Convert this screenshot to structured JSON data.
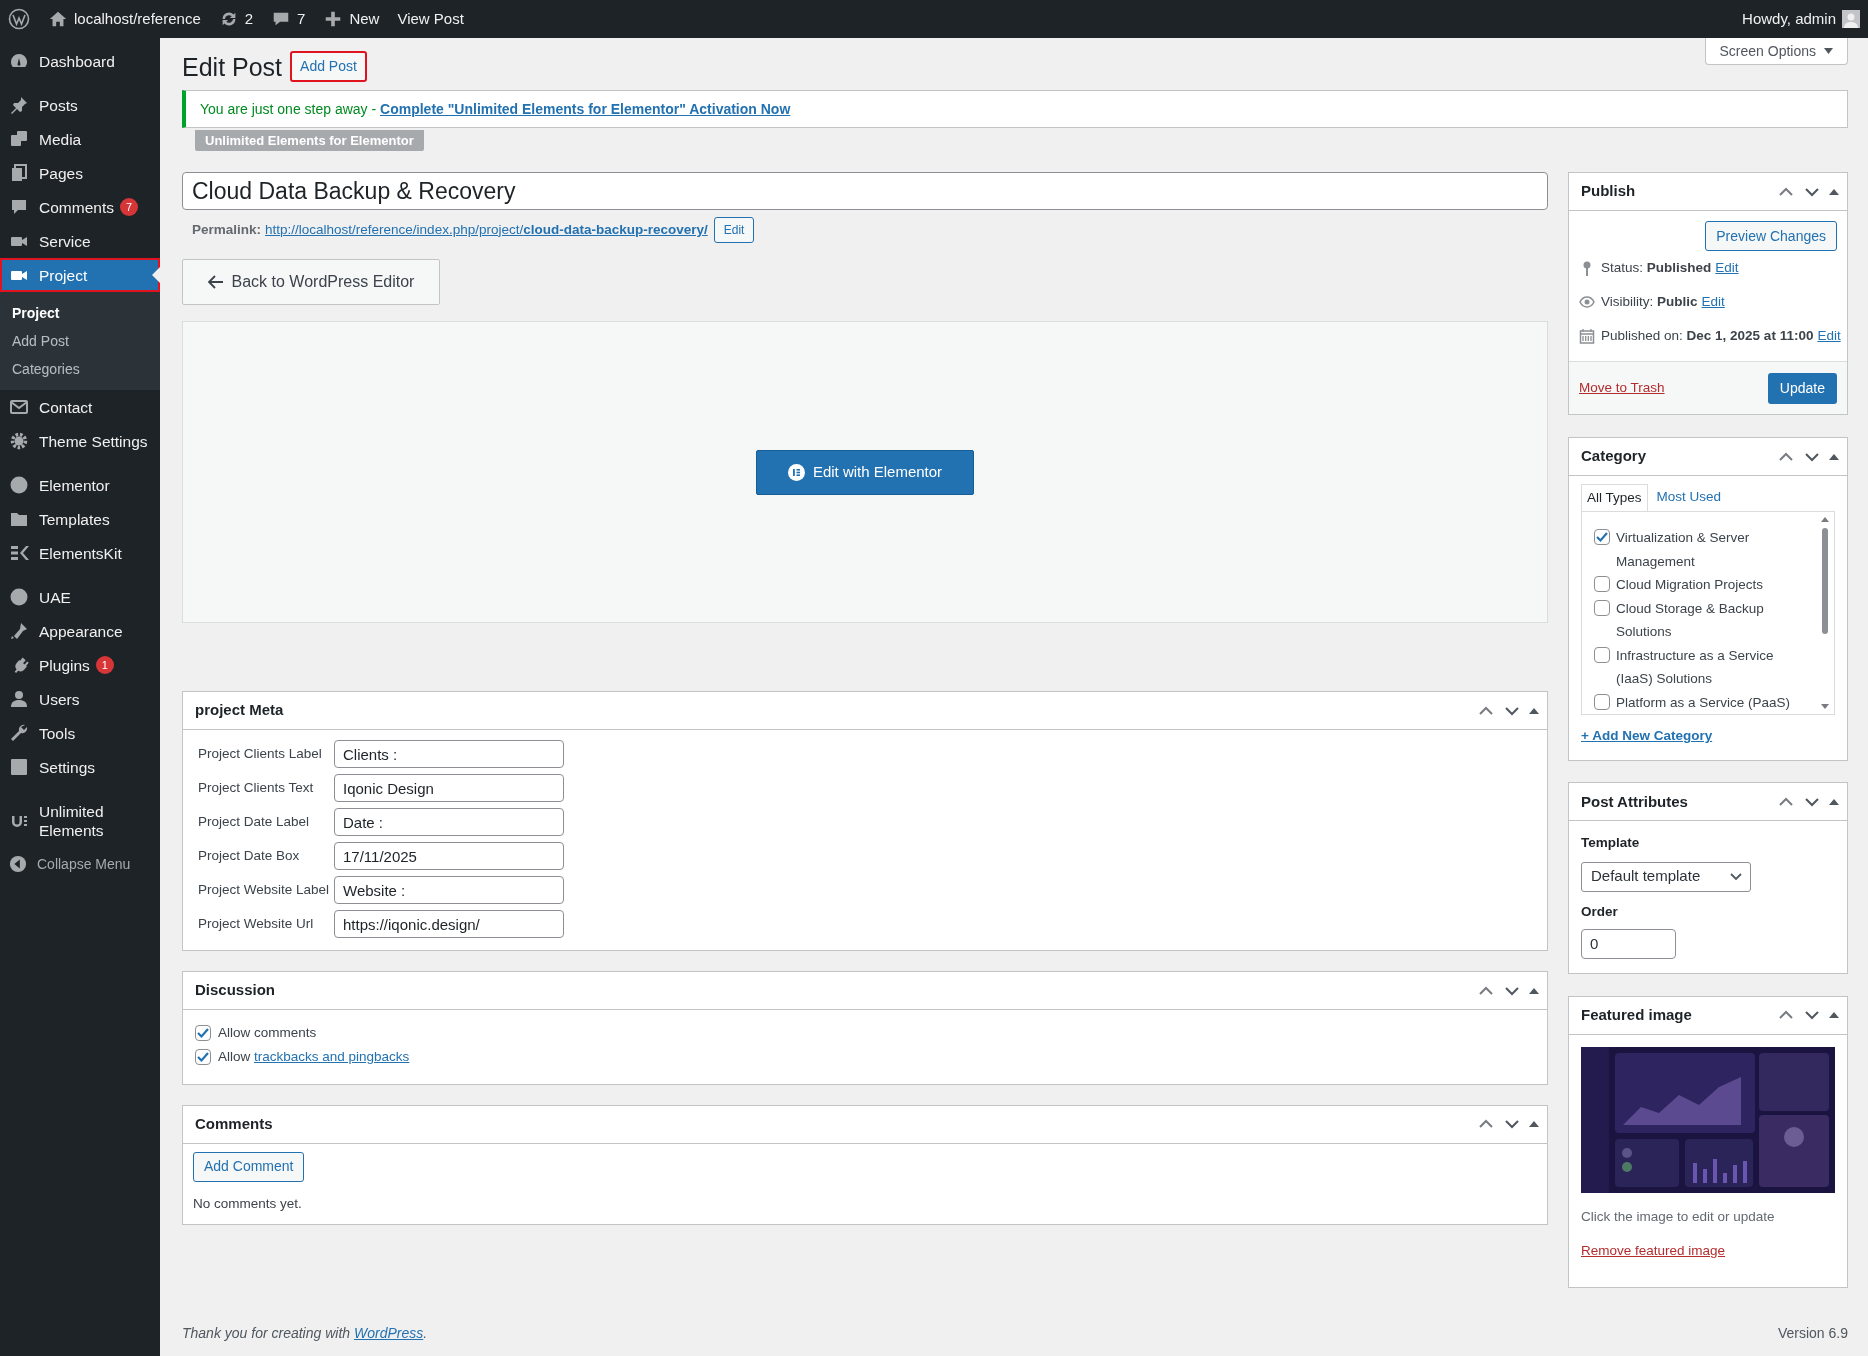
{
  "admin_bar": {
    "items": [
      {
        "kind": "logo"
      },
      {
        "kind": "site",
        "label": "localhost/reference"
      },
      {
        "kind": "updates",
        "label": "2"
      },
      {
        "kind": "comments",
        "label": "7"
      },
      {
        "kind": "new",
        "label": "New"
      },
      {
        "kind": "link",
        "label": "View Post"
      }
    ],
    "greeting": "Howdy, admin"
  },
  "sidebar": {
    "groups": [
      [
        {
          "label": "Dashboard",
          "selected": false,
          "outlined": false
        }
      ],
      [
        {
          "label": "Posts",
          "selected": false,
          "outlined": false
        },
        {
          "label": "Media",
          "selected": false,
          "outlined": false
        },
        {
          "label": "Pages",
          "selected": false,
          "outlined": false
        },
        {
          "label": "Comments",
          "badge": "7",
          "selected": false,
          "outlined": false
        },
        {
          "label": "Service",
          "selected": false,
          "outlined": false
        },
        {
          "label": "Project",
          "selected": true,
          "outlined": true,
          "children": [
            {
              "label": "Project",
              "selected": true
            },
            {
              "label": "Add Post",
              "selected": false
            },
            {
              "label": "Categories",
              "selected": false
            }
          ]
        },
        {
          "label": "Contact",
          "selected": false,
          "outlined": false
        },
        {
          "label": "Theme Settings",
          "selected": false,
          "outlined": false
        }
      ],
      [
        {
          "label": "Elementor",
          "selected": false,
          "outlined": false
        },
        {
          "label": "Templates",
          "selected": false,
          "outlined": false
        },
        {
          "label": "ElementsKit",
          "selected": false,
          "outlined": false
        }
      ],
      [
        {
          "label": "UAE",
          "selected": false,
          "outlined": false
        },
        {
          "label": "Appearance",
          "selected": false,
          "outlined": false
        },
        {
          "label": "Plugins",
          "badge": "1",
          "selected": false,
          "outlined": false
        },
        {
          "label": "Users",
          "selected": false,
          "outlined": false
        },
        {
          "label": "Tools",
          "selected": false,
          "outlined": false
        },
        {
          "label": "Settings",
          "selected": false,
          "outlined": false
        }
      ],
      [
        {
          "label": "Unlimited Elements",
          "selected": false,
          "outlined": false
        }
      ]
    ],
    "collapse": "Collapse Menu"
  },
  "header": {
    "title": "Edit Post",
    "add_button": {
      "label": "Add Post",
      "outlined": true
    },
    "screen_options": "Screen Options"
  },
  "notice": {
    "text": "You are just one step away - ",
    "link": "Complete \"Unlimited Elements for Elementor\" Activation Now",
    "tag": "Unlimited Elements for Elementor"
  },
  "post": {
    "title": "Cloud Data Backup & Recovery",
    "permalink_label": "Permalink:",
    "permalink": "http://localhost/reference/index.php/project/**cloud-data-backup-recovery/**",
    "permalink_edit": "Edit",
    "back_button": "Back to WordPress Editor",
    "elementor_button": "Edit with Elementor"
  },
  "project_meta": {
    "title": "project Meta",
    "fields": [
      {
        "label": "Project Clients Label",
        "value": "Clients :"
      },
      {
        "label": "Project Clients Text",
        "value": "Iqonic Design"
      },
      {
        "label": "Project Date Label",
        "value": "Date :"
      },
      {
        "label": "Project Date Box",
        "value": "17/11/2025"
      },
      {
        "label": "Project Website Label",
        "value": "Website :"
      },
      {
        "label": "Project Website Url",
        "value": "https://iqonic.design/"
      }
    ]
  },
  "discussion": {
    "title": "Discussion",
    "options": [
      {
        "text": "Allow comments",
        "checked": true
      },
      {
        "text": "Allow ",
        "link": "trackbacks and pingbacks",
        "checked": true
      }
    ]
  },
  "comments": {
    "title": "Comments",
    "button": "Add Comment",
    "empty": "No comments yet."
  },
  "publish": {
    "title": "Publish",
    "preview_button": "Preview Changes",
    "rows": [
      {
        "kind": "status",
        "text": "Status: **Published**",
        "link": "Edit"
      },
      {
        "kind": "visibility",
        "text": "Visibility: **Public**",
        "link": "Edit"
      },
      {
        "kind": "date",
        "text": "Published on: **Dec 1, 2025 at 11:00**",
        "link": "Edit"
      }
    ],
    "trash": "Move to Trash",
    "update": "Update"
  },
  "category": {
    "title": "Category",
    "tabs": [
      {
        "label": "All Types",
        "selected": true
      },
      {
        "label": "Most Used",
        "selected": false
      }
    ],
    "items": [
      {
        "label": "Virtualization & Server Management",
        "checked": true
      },
      {
        "label": "Cloud Migration Projects",
        "checked": false
      },
      {
        "label": "Cloud Storage & Backup Solutions",
        "checked": false
      },
      {
        "label": "Infrastructure as a Service (IaaS) Solutions",
        "checked": false
      },
      {
        "label": "Platform as a Service (PaaS)",
        "checked": false
      }
    ],
    "add_link": "+ Add New Category"
  },
  "post_attributes": {
    "title": "Post Attributes",
    "template_label": "Template",
    "template": "Default template",
    "order_label": "Order",
    "order": "0"
  },
  "featured_image": {
    "title": "Featured image",
    "hint": "Click the image to edit or update",
    "remove": "Remove featured image"
  },
  "footer": {
    "text": "Thank you for creating with ",
    "link": "WordPress",
    "end": ".",
    "version": "Version 6.9"
  }
}
